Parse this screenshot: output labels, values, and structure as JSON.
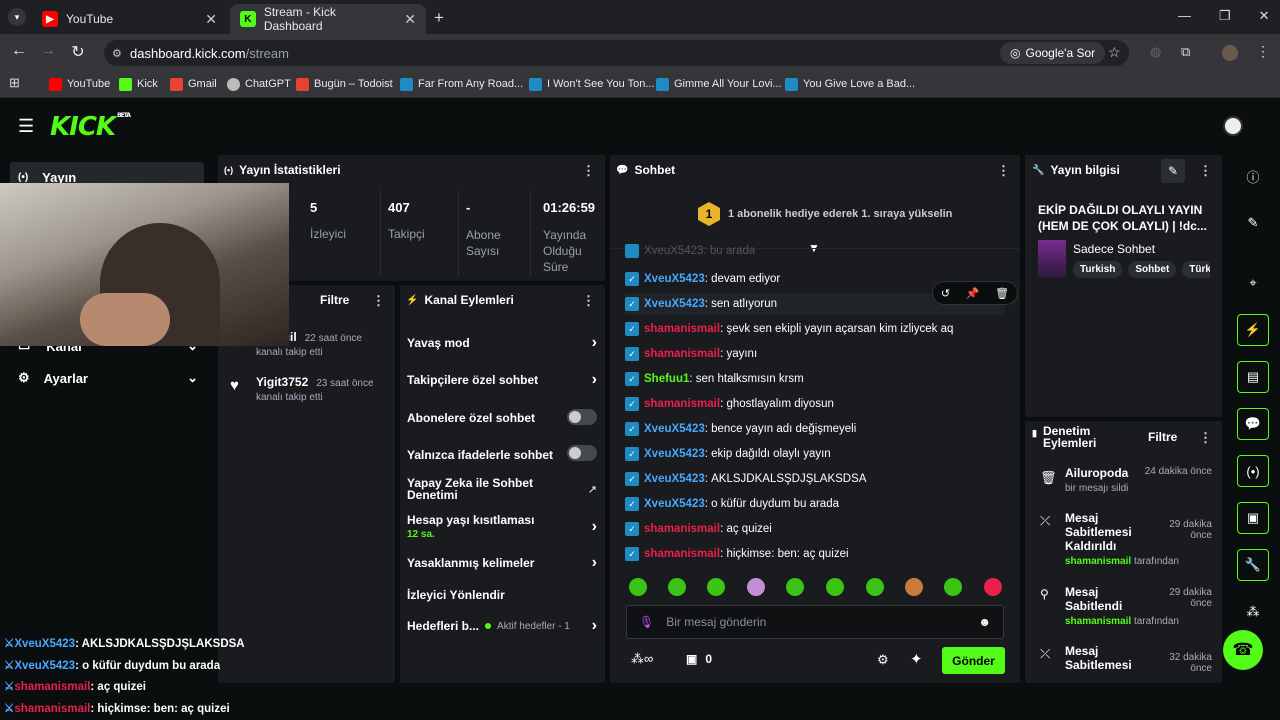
{
  "browser": {
    "tabs": [
      {
        "label": "YouTube"
      },
      {
        "label": "Stream - Kick Dashboard"
      }
    ],
    "url_host": "dashboard.kick.com",
    "url_path": "/stream",
    "google_lens": "Google'a Sor",
    "bookmarks": [
      "YouTube",
      "Kick",
      "Gmail",
      "ChatGPT",
      "Bugün – Todoist",
      "Far From Any Road...",
      "I Won't See You Ton...",
      "Gimme All Your Lovi...",
      "You Give Love a Bad..."
    ]
  },
  "app": {
    "logo": "KICK",
    "logo_tag": "BETA"
  },
  "sidebar": {
    "items": [
      {
        "label": "Yayın"
      },
      {
        "label": "Kanal"
      },
      {
        "label": "Ayarlar"
      }
    ]
  },
  "stats": {
    "title": "Yayın İstatistikleri",
    "items": [
      {
        "value": "5",
        "label": "İzleyici"
      },
      {
        "value": "407",
        "label": "Takipçi"
      },
      {
        "value": "-",
        "label": "Abone Sayısı"
      },
      {
        "value": "01:26:59",
        "label": "Yayında Olduğu Süre"
      }
    ]
  },
  "activity": {
    "filter": "Filtre",
    "items": [
      {
        "user": "__n_cil",
        "time": "22 saat önce",
        "action": "kanalı takip etti"
      },
      {
        "user": "Yigit3752",
        "time": "23 saat önce",
        "action": "kanalı takip etti"
      }
    ]
  },
  "channel_actions": {
    "title": "Kanal Eylemleri",
    "items": [
      {
        "label": "Yavaş mod"
      },
      {
        "label": "Takipçilere özel sohbet"
      },
      {
        "label": "Abonelere özel sohbet"
      },
      {
        "label": "Yalnızca ifadelerle sohbet"
      },
      {
        "label": "Yapay Zeka ile Sohbet Denetimi"
      },
      {
        "label": "Hesap yaşı kısıtlaması",
        "sub": "12 sa."
      },
      {
        "label": "Yasaklanmış kelimeler"
      },
      {
        "label": "İzleyici Yönlendir"
      },
      {
        "label": "Hedefleri b...",
        "sub": "Aktif hedefler - 1"
      }
    ]
  },
  "chat": {
    "title": "Sohbet",
    "gift_banner": "1 abonelik hediye ederek 1. sıraya yükselin",
    "gift_rank": "1",
    "top_line": "XveuX5423: bu arada",
    "messages": [
      {
        "user": "XveuX5423",
        "text": "devam ediyor",
        "c": "u1"
      },
      {
        "user": "XveuX5423",
        "text": "sen atlıyorun",
        "c": "u1"
      },
      {
        "user": "shamanismail",
        "text": "şevk sen ekipli yayın açarsan kim izliycek aq",
        "c": "u2"
      },
      {
        "user": "shamanismail",
        "text": "yayını",
        "c": "u2"
      },
      {
        "user": "Shefuu1",
        "text": "sen htalksmısın krsm",
        "c": "u3"
      },
      {
        "user": "shamanismail",
        "text": "ghostlayalım diyosun",
        "c": "u2"
      },
      {
        "user": "XveuX5423",
        "text": "bence yayın adı değişmeyeli",
        "c": "u1"
      },
      {
        "user": "XveuX5423",
        "text": "ekip dağıldı olaylı yayın",
        "c": "u1"
      },
      {
        "user": "XveuX5423",
        "text": "AKLSJDKALSŞDJŞLAKSDSA",
        "c": "u1"
      },
      {
        "user": "XveuX5423",
        "text": "o küfür duydum bu arada",
        "c": "u1"
      },
      {
        "user": "shamanismail",
        "text": "aç quizei",
        "c": "u2"
      },
      {
        "user": "shamanismail",
        "text": "hiçkimse: ben: aç quizei",
        "c": "u2"
      }
    ],
    "input_placeholder": "Bir mesaj gönderin",
    "points": "0",
    "send": "Gönder"
  },
  "stream_info": {
    "title": "Yayın bilgisi",
    "stream_title": "EKİP DAĞILDI OLAYLI YAYIN (HEM DE ÇOK OLAYLI) | !dc...",
    "category": "Sadece Sohbet",
    "tags": [
      "Turkish",
      "Sohbet",
      "Türk"
    ]
  },
  "moderation": {
    "title": "Denetim Eylemleri",
    "filter": "Filtre",
    "items": [
      {
        "user": "Ailuropoda",
        "time": "24 dakika önce",
        "desc": "bir mesajı sildi"
      },
      {
        "user": "Mesaj Sabitlemesi Kaldırıldı",
        "time": "29 dakika önce",
        "who": "shamanismail",
        "desc": "tarafından"
      },
      {
        "user": "Mesaj Sabitlendi",
        "time": "29 dakika önce",
        "who": "shamanismail",
        "desc": "tarafından"
      },
      {
        "user": "Mesaj Sabitlemesi",
        "time": "32 dakika önce"
      }
    ]
  },
  "overlay_chat": [
    {
      "user": "XveuX5423",
      "text": "AKLSJDKALSŞDJŞLAKSDSA",
      "c": "u1"
    },
    {
      "user": "XveuX5423",
      "text": "o küfür duydum bu arada",
      "c": "u1"
    },
    {
      "user": "shamanismail",
      "text": "aç quizei",
      "c": "u2"
    },
    {
      "user": "shamanismail",
      "text": "hiçkimse: ben: aç quizei",
      "c": "u2"
    }
  ],
  "colors": {
    "accent": "#53fc18",
    "bg": "#0b0e0f",
    "panel": "#191b1f",
    "user_blue": "#4aa8ff",
    "user_red": "#e8214b"
  }
}
